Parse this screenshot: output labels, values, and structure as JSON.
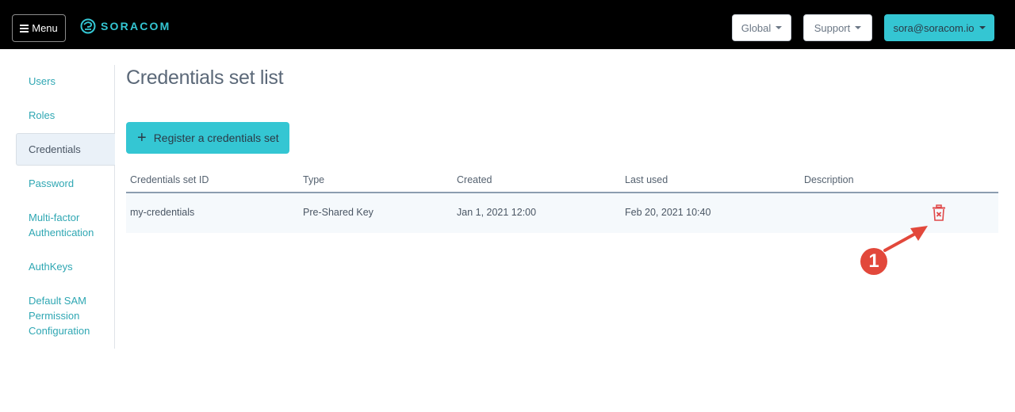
{
  "navbar": {
    "menu_label": "Menu",
    "logo_text": "SORACOM",
    "coverage_label": "Global",
    "support_label": "Support",
    "user_label": "sora@soracom.io",
    "accent_color": "#34c6d3"
  },
  "sidebar": {
    "items": [
      {
        "label": "Users",
        "active": false
      },
      {
        "label": "Roles",
        "active": false
      },
      {
        "label": "Credentials",
        "active": true
      },
      {
        "label": "Password",
        "active": false
      },
      {
        "label": "Multi-factor Authentication",
        "lines": [
          "Multi-factor",
          "Authentication"
        ],
        "active": false
      },
      {
        "label": "AuthKeys",
        "active": false
      },
      {
        "label": "Default SAM Permission Configuration",
        "lines": [
          "Default SAM",
          "Permission",
          "Configuration"
        ],
        "active": false
      }
    ]
  },
  "main": {
    "title": "Credentials set list",
    "register_button": {
      "icon": "plus-icon",
      "label": "Register a credentials set"
    },
    "table": {
      "columns": [
        "Credentials set ID",
        "Type",
        "Created",
        "Last used",
        "Description"
      ],
      "rows": [
        {
          "id": "my-credentials",
          "type": "Pre-Shared Key",
          "created": "Jan 1, 2021 12:00",
          "last_used": "Feb 20, 2021 10:40",
          "description": "",
          "action_icon": "trash-icon"
        }
      ]
    }
  },
  "annotation": {
    "number": "1",
    "color": "#e2483b",
    "points_to": "delete-credentials-button"
  }
}
